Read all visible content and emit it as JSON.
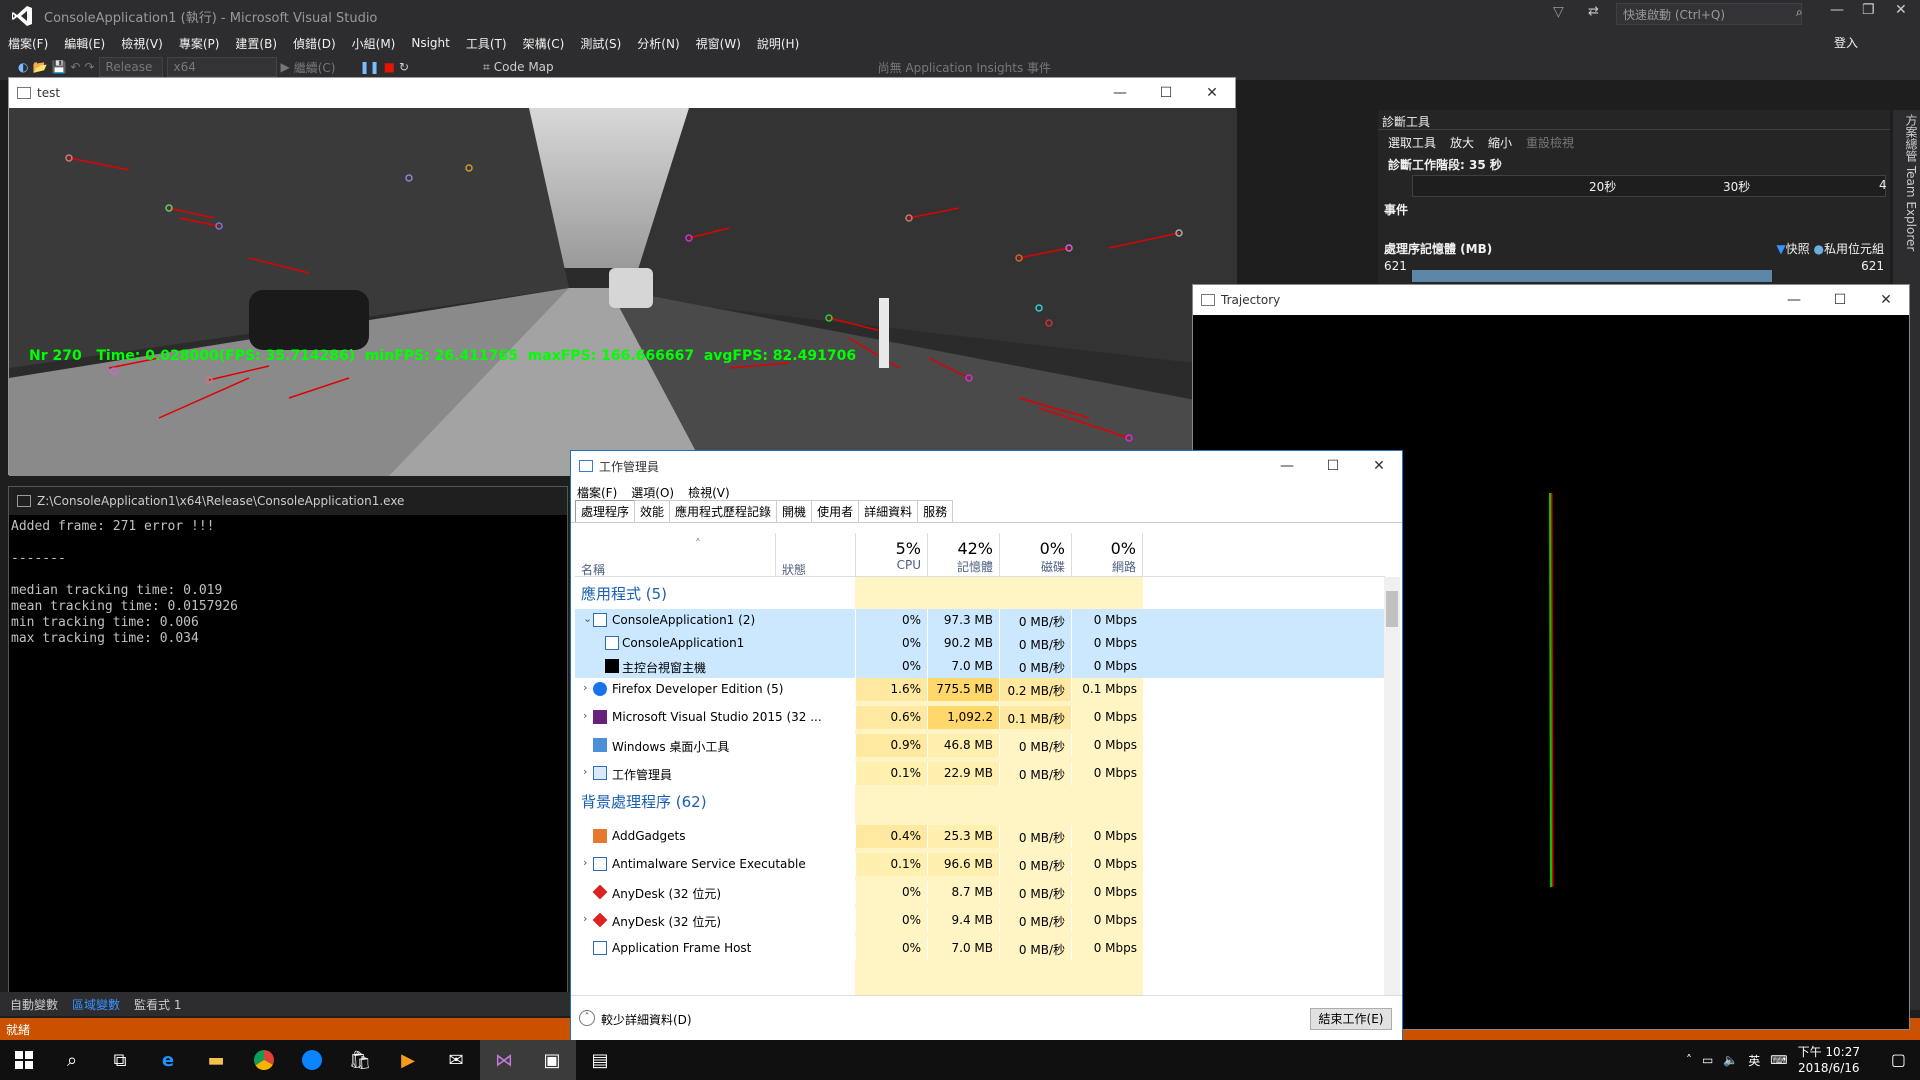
{
  "vs": {
    "title": "ConsoleApplication1 (執行) - Microsoft Visual Studio",
    "quick_launch": "快速啟動 (Ctrl+Q)",
    "sign_in": "登入",
    "menu": [
      "檔案(F)",
      "編輯(E)",
      "檢視(V)",
      "專案(P)",
      "建置(B)",
      "偵錯(D)",
      "小組(M)",
      "Nsight",
      "工具(T)",
      "架構(C)",
      "測試(S)",
      "分析(N)",
      "視窗(W)",
      "說明(H)"
    ],
    "toolbar": {
      "config": "Release",
      "platform": "x64",
      "continue": "繼續(C)",
      "codemap": "Code Map",
      "insights": "尚無 Application Insights 事件"
    },
    "status": "就緒",
    "bottom_tabs": [
      "自動變數",
      "區域變數",
      "監看式 1"
    ],
    "team_explorer": "方案總管  Team Explorer"
  },
  "diag": {
    "title": "診斷工具",
    "select_tool": "選取工具",
    "zoom_in": "放大",
    "zoom_out": "縮小",
    "reset": "重設檢視",
    "session": "診斷工作階段: 35 秒",
    "tick1": "20秒",
    "tick2": "30秒",
    "tick3": "4",
    "events": "事件",
    "memory": "處理序記憶體 (MB)",
    "snapshot": "快照",
    "private": "私用位元組",
    "mem_left": "621",
    "mem_right": "621"
  },
  "test_window": {
    "title": "test",
    "overlay": "Nr 270   Time: 0.028000(FPS: 35.714286)  minFPS: 26.411765  maxFPS: 166.666667  avgFPS: 82.491706"
  },
  "console_window": {
    "title": "Z:\\ConsoleApplication1\\x64\\Release\\ConsoleApplication1.exe",
    "text": "Added frame: 271 error !!!\n\n-------\n\nmedian tracking time: 0.019\nmean tracking time: 0.0157926\nmin tracking time: 0.006\nmax tracking time: 0.034"
  },
  "trajectory_window": {
    "title": "Trajectory"
  },
  "task_manager": {
    "title": "工作管理員",
    "menu": [
      "檔案(F)",
      "選項(O)",
      "檢視(V)"
    ],
    "tabs": [
      "處理程序",
      "效能",
      "應用程式歷程記錄",
      "開機",
      "使用者",
      "詳細資料",
      "服務"
    ],
    "col_name": "名稱",
    "col_status": "狀態",
    "metrics": [
      {
        "pct": "5%",
        "label": "CPU"
      },
      {
        "pct": "42%",
        "label": "記憶體"
      },
      {
        "pct": "0%",
        "label": "磁碟"
      },
      {
        "pct": "0%",
        "label": "網路"
      }
    ],
    "group_apps": "應用程式 (5)",
    "group_bg": "背景處理程序 (62)",
    "rows": [
      {
        "name": "ConsoleApplication1 (2)",
        "cpu": "0%",
        "mem": "97.3 MB",
        "disk": "0 MB/秒",
        "net": "0 Mbps"
      },
      {
        "name": "ConsoleApplication1",
        "cpu": "0%",
        "mem": "90.2 MB",
        "disk": "0 MB/秒",
        "net": "0 Mbps"
      },
      {
        "name": "主控台視窗主機",
        "cpu": "0%",
        "mem": "7.0 MB",
        "disk": "0 MB/秒",
        "net": "0 Mbps"
      },
      {
        "name": "Firefox Developer Edition (5)",
        "cpu": "1.6%",
        "mem": "775.5 MB",
        "disk": "0.2 MB/秒",
        "net": "0.1 Mbps"
      },
      {
        "name": "Microsoft Visual Studio 2015 (32 ...",
        "cpu": "0.6%",
        "mem": "1,092.2",
        "disk": "0.1 MB/秒",
        "net": "0 Mbps"
      },
      {
        "name": "Windows 桌面小工具",
        "cpu": "0.9%",
        "mem": "46.8 MB",
        "disk": "0 MB/秒",
        "net": "0 Mbps"
      },
      {
        "name": "工作管理員",
        "cpu": "0.1%",
        "mem": "22.9 MB",
        "disk": "0 MB/秒",
        "net": "0 Mbps"
      },
      {
        "name": "AddGadgets",
        "cpu": "0.4%",
        "mem": "25.3 MB",
        "disk": "0 MB/秒",
        "net": "0 Mbps"
      },
      {
        "name": "Antimalware Service Executable",
        "cpu": "0.1%",
        "mem": "96.6 MB",
        "disk": "0 MB/秒",
        "net": "0 Mbps"
      },
      {
        "name": "AnyDesk (32 位元)",
        "cpu": "0%",
        "mem": "8.7 MB",
        "disk": "0 MB/秒",
        "net": "0 Mbps"
      },
      {
        "name": "AnyDesk (32 位元)",
        "cpu": "0%",
        "mem": "9.4 MB",
        "disk": "0 MB/秒",
        "net": "0 Mbps"
      },
      {
        "name": "Application Frame Host",
        "cpu": "0%",
        "mem": "7.0 MB",
        "disk": "0 MB/秒",
        "net": "0 Mbps"
      }
    ],
    "fewer_details": "較少詳細資料(D)",
    "end_task": "結束工作(E)"
  },
  "taskbar": {
    "ime": "英",
    "time": "下午 10:27",
    "date": "2018/6/16"
  }
}
